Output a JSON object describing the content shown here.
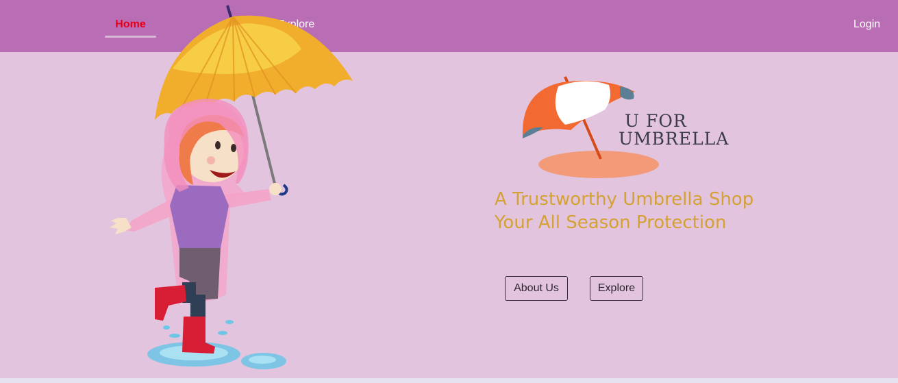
{
  "nav": {
    "home_label": "Home",
    "explore_label": "Explore",
    "login_label": "Login"
  },
  "logo": {
    "line1": "U FOR",
    "line2": "UMBRELLA"
  },
  "hero": {
    "tagline_line1": "A Trustworthy Umbrella Shop",
    "tagline_line2": "Your All Season Protection"
  },
  "buttons": {
    "about_label": "About Us",
    "explore_label": "Explore"
  },
  "colors": {
    "navbar": "#b96db5",
    "hero_background": "#e2c4de",
    "active_nav": "#e8001a",
    "tagline": "#d4a135"
  }
}
